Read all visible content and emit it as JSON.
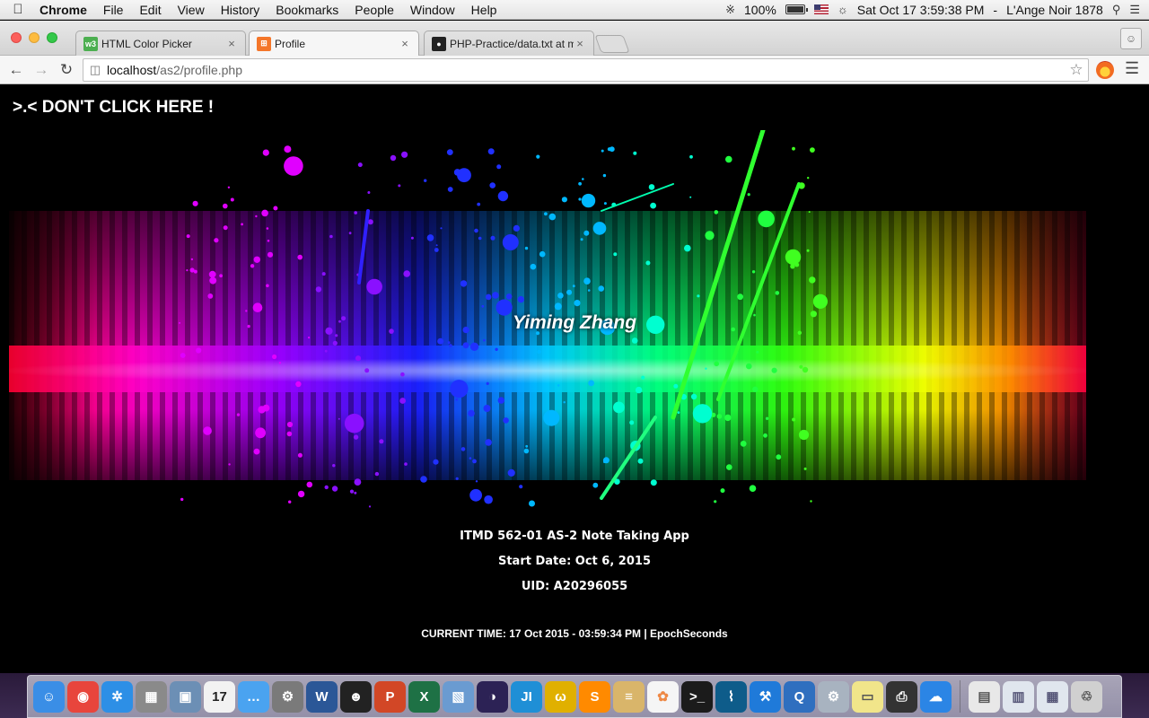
{
  "menubar": {
    "app_name": "Chrome",
    "items": [
      "File",
      "Edit",
      "View",
      "History",
      "Bookmarks",
      "People",
      "Window",
      "Help"
    ],
    "battery_percent": "100%",
    "battery_level": 1.0,
    "clock": "Sat Oct 17  3:59:38 PM",
    "user": "L'Ange Noir 1878"
  },
  "browser": {
    "tabs": [
      {
        "title": "HTML Color Picker",
        "favicon": "w3schools-icon",
        "favicon_text": "w3",
        "favicon_color": "#4caf50",
        "active": false
      },
      {
        "title": "Profile",
        "favicon": "xampp-icon",
        "favicon_text": "⊞",
        "favicon_color": "#f4762a",
        "active": true
      },
      {
        "title": "PHP-Practice/data.txt at m",
        "favicon": "github-icon",
        "favicon_text": "●",
        "favicon_color": "#222222",
        "active": false
      }
    ],
    "close_glyph": "×",
    "url_host": "localhost",
    "url_path": "/as2/profile.php"
  },
  "page": {
    "link_text": ">.< DON'T CLICK HERE !",
    "name": "Yiming Zhang",
    "course": "ITMD 562-01 AS-2 Note Taking App",
    "start_date": "Start Date: Oct 6, 2015",
    "uid": "UID: A20296055",
    "current_time": "CURRENT TIME: 17 Oct 2015 - 03:59:34 PM | EpochSeconds"
  },
  "dock": {
    "apps": [
      {
        "name": "finder-icon",
        "color": "#3a8ee6",
        "glyph": "☺"
      },
      {
        "name": "chrome-icon",
        "color": "#e8453c",
        "glyph": "◉"
      },
      {
        "name": "safari-icon",
        "color": "#2d8fe6",
        "glyph": "✲"
      },
      {
        "name": "calculator-icon",
        "color": "#8a8a8a",
        "glyph": "▦"
      },
      {
        "name": "preview-icon",
        "color": "#6c8fb5",
        "glyph": "▣"
      },
      {
        "name": "calendar-icon",
        "color": "#f2f2f2",
        "glyph": "17",
        "text_color": "#222"
      },
      {
        "name": "messages-icon",
        "color": "#4aa3f0",
        "glyph": "…"
      },
      {
        "name": "system-preferences-icon",
        "color": "#7a7a7a",
        "glyph": "⚙"
      },
      {
        "name": "word-icon",
        "color": "#2b5797",
        "glyph": "W"
      },
      {
        "name": "qq-icon",
        "color": "#222222",
        "glyph": "☻"
      },
      {
        "name": "powerpoint-icon",
        "color": "#d24726",
        "glyph": "P"
      },
      {
        "name": "excel-icon",
        "color": "#1e7145",
        "glyph": "X"
      },
      {
        "name": "virtualbox-icon",
        "color": "#6a9bd1",
        "glyph": "▧"
      },
      {
        "name": "eclipse-icon",
        "color": "#2c2255",
        "glyph": "◑"
      },
      {
        "name": "jetbrains-icon",
        "color": "#1f8fd6",
        "glyph": "JI"
      },
      {
        "name": "wrapper-icon",
        "color": "#e0b000",
        "glyph": "ω"
      },
      {
        "name": "sublime-icon",
        "color": "#ff8a00",
        "glyph": "S"
      },
      {
        "name": "notes-icon",
        "color": "#d9b56a",
        "glyph": "≡"
      },
      {
        "name": "photos-icon",
        "color": "#f5f5f5",
        "glyph": "✿",
        "text_color": "#e84"
      },
      {
        "name": "terminal-icon",
        "color": "#1b1b1b",
        "glyph": ">_"
      },
      {
        "name": "mysql-workbench-icon",
        "color": "#0e5c8a",
        "glyph": "⌇"
      },
      {
        "name": "xcode-icon",
        "color": "#1f7ad9",
        "glyph": "⚒"
      },
      {
        "name": "quicktime-icon",
        "color": "#2f6fbf",
        "glyph": "Q"
      },
      {
        "name": "system-utility-icon",
        "color": "#a8b3c0",
        "glyph": "⚙"
      },
      {
        "name": "stickies-icon",
        "color": "#f1e58a",
        "glyph": "▭",
        "text_color": "#555"
      },
      {
        "name": "printer-icon",
        "color": "#333333",
        "glyph": "⎙"
      },
      {
        "name": "icloud-icon",
        "color": "#2b85e5",
        "glyph": "☁"
      }
    ],
    "tray": [
      {
        "name": "archive-icon",
        "color": "#e8e8e8",
        "glyph": "▤",
        "text_color": "#555"
      },
      {
        "name": "documents-folder-icon",
        "color": "#e0e6ee",
        "glyph": "▥",
        "text_color": "#557"
      },
      {
        "name": "downloads-folder-icon",
        "color": "#e0e6ee",
        "glyph": "▦",
        "text_color": "#557"
      },
      {
        "name": "trash-icon",
        "color": "#d0d0d0",
        "glyph": "♲",
        "text_color": "#555"
      }
    ]
  }
}
